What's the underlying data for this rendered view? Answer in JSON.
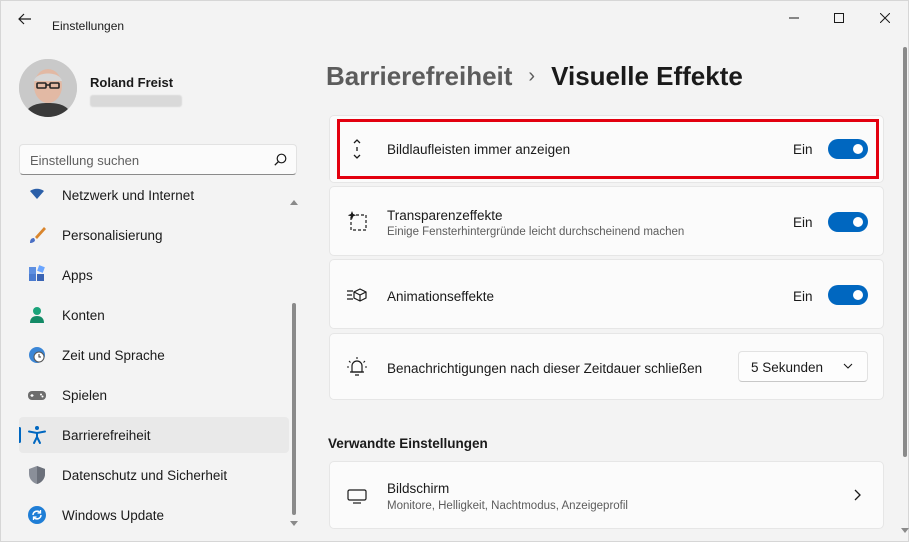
{
  "app": {
    "title": "Einstellungen"
  },
  "profile": {
    "name": "Roland Freist"
  },
  "search": {
    "placeholder": "Einstellung suchen"
  },
  "sidebar": {
    "items": [
      {
        "label": "Netzwerk und Internet",
        "icon": "network-icon"
      },
      {
        "label": "Personalisierung",
        "icon": "brush-icon"
      },
      {
        "label": "Apps",
        "icon": "apps-icon"
      },
      {
        "label": "Konten",
        "icon": "person-icon"
      },
      {
        "label": "Zeit und Sprache",
        "icon": "globe-clock-icon"
      },
      {
        "label": "Spielen",
        "icon": "gamepad-icon"
      },
      {
        "label": "Barrierefreiheit",
        "icon": "accessibility-icon",
        "active": true
      },
      {
        "label": "Datenschutz und Sicherheit",
        "icon": "shield-icon"
      },
      {
        "label": "Windows Update",
        "icon": "update-icon"
      }
    ]
  },
  "breadcrumb": {
    "parent": "Barrierefreiheit",
    "separator": "›",
    "current": "Visuelle Effekte"
  },
  "settings": {
    "scrollbars": {
      "title": "Bildlaufleisten immer anzeigen",
      "state": "Ein",
      "on": true
    },
    "transparency": {
      "title": "Transparenzeffekte",
      "subtitle": "Einige Fensterhintergründe leicht durchscheinend machen",
      "state": "Ein",
      "on": true
    },
    "animation": {
      "title": "Animationseffekte",
      "state": "Ein",
      "on": true
    },
    "notifications": {
      "title": "Benachrichtigungen nach dieser Zeitdauer schließen",
      "selected": "5 Sekunden"
    }
  },
  "related": {
    "heading": "Verwandte Einstellungen",
    "display": {
      "title": "Bildschirm",
      "subtitle": "Monitore, Helligkeit, Nachtmodus, Anzeigeprofil"
    }
  },
  "colors": {
    "accent": "#0067c0",
    "highlight": "#e3000f"
  }
}
